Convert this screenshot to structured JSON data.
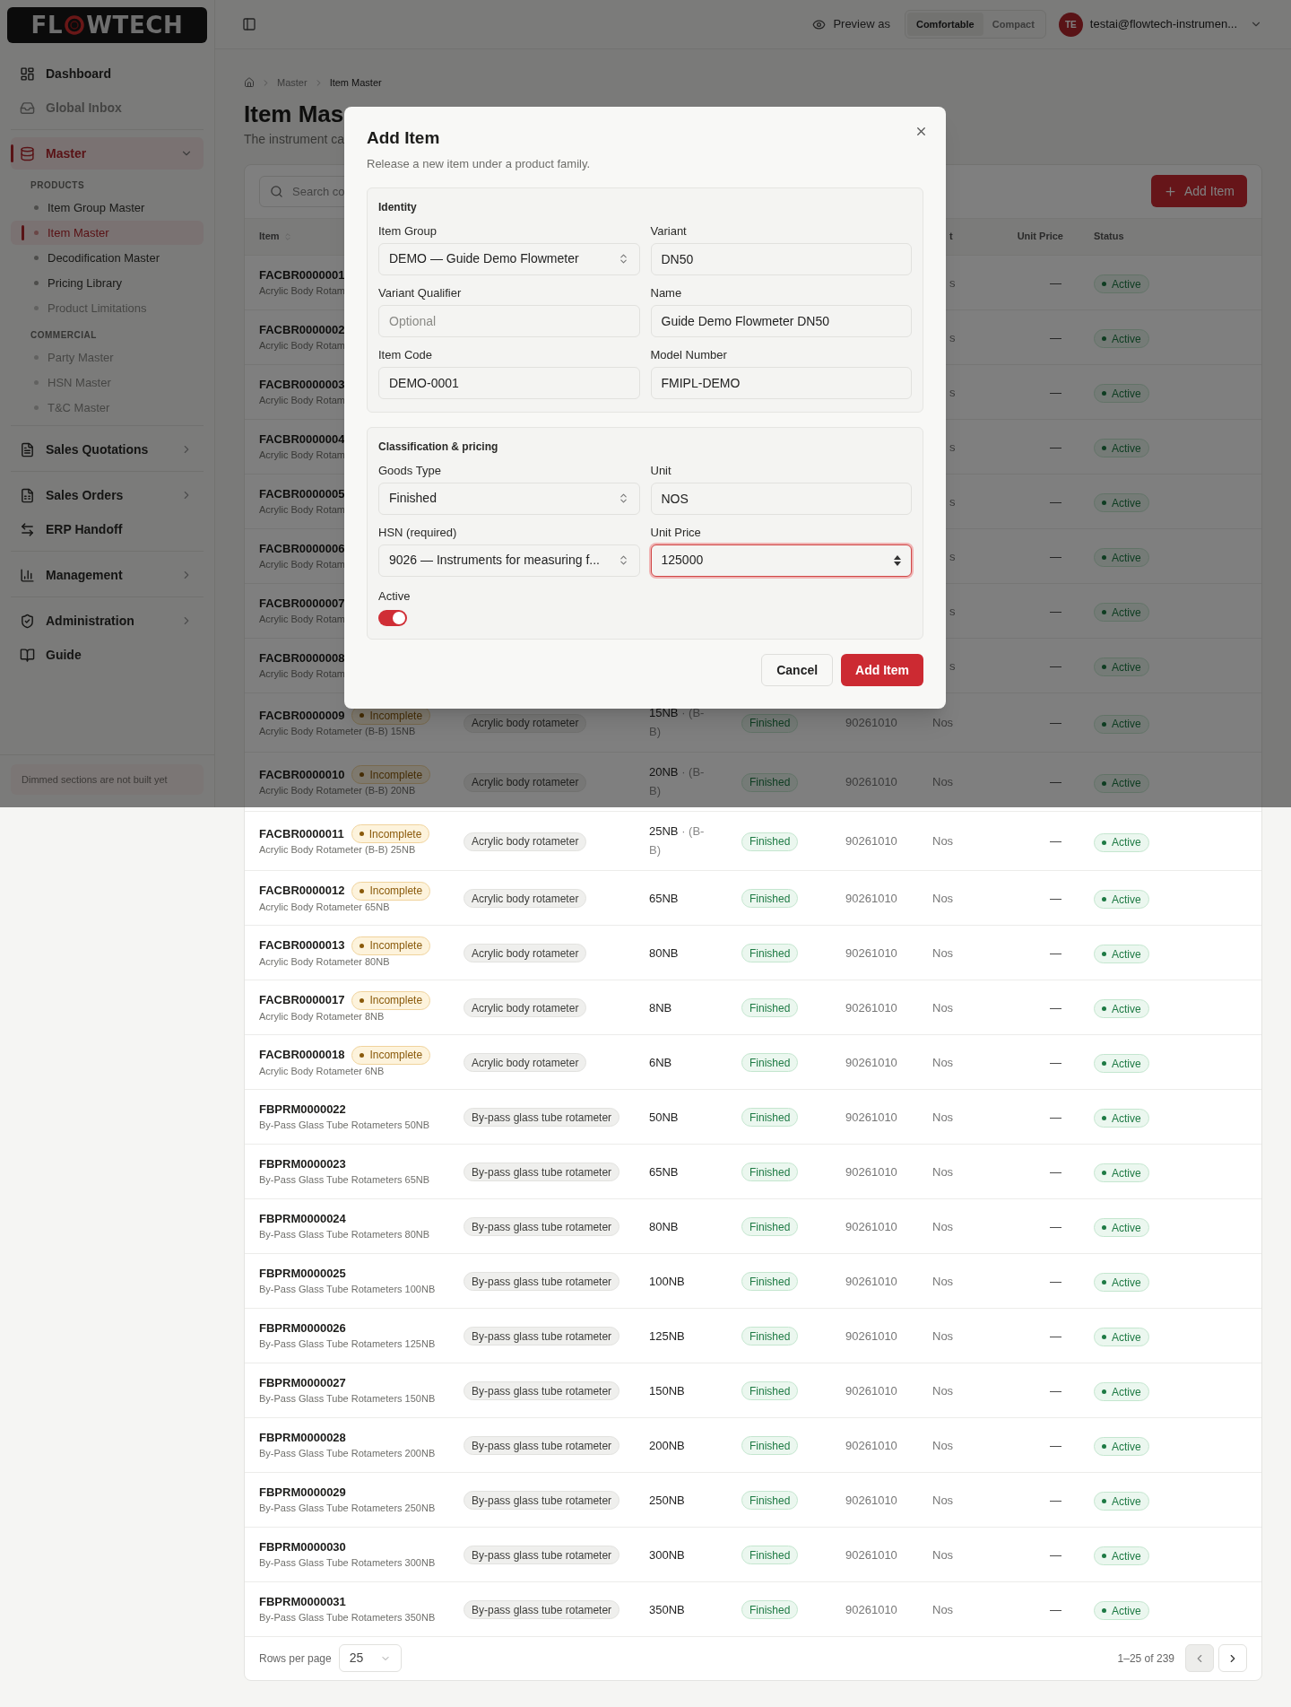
{
  "sidebar": {
    "logo": {
      "parts": [
        "FL",
        "WTECH"
      ]
    },
    "groups": [
      [
        {
          "label": "Dashboard",
          "kind": "link",
          "selected": false,
          "dimmed": false
        },
        {
          "label": "Global Inbox",
          "kind": "link",
          "selected": false,
          "dimmed": true
        }
      ],
      [
        {
          "label": "Master",
          "kind": "expandable",
          "selected": true,
          "expanded": true,
          "sections": [
            {
              "heading": "PRODUCTS",
              "items": [
                {
                  "label": "Item Group Master",
                  "selected": false,
                  "dimmed": false
                },
                {
                  "label": "Item Master",
                  "selected": true
                },
                {
                  "label": "Decodification Master",
                  "selected": false,
                  "dimmed": false
                },
                {
                  "label": "Pricing Library",
                  "selected": false,
                  "dimmed": false
                },
                {
                  "label": "Product Limitations",
                  "selected": false,
                  "dimmed": true
                }
              ]
            },
            {
              "heading": "COMMERCIAL",
              "items": [
                {
                  "label": "Party Master",
                  "selected": false,
                  "dimmed": true
                },
                {
                  "label": "HSN Master",
                  "selected": false,
                  "dimmed": true
                },
                {
                  "label": "T&C Master",
                  "selected": false,
                  "dimmed": true
                }
              ]
            }
          ]
        }
      ],
      [
        {
          "label": "Sales Quotations",
          "kind": "expandable",
          "selected": false,
          "dimmed": false,
          "expanded": false
        }
      ],
      [
        {
          "label": "Sales Orders",
          "kind": "expandable",
          "selected": false,
          "dimmed": false,
          "expanded": false
        },
        {
          "label": "ERP Handoff",
          "kind": "link",
          "selected": false,
          "dimmed": false
        }
      ],
      [
        {
          "label": "Management",
          "kind": "expandable",
          "selected": false,
          "dimmed": false,
          "expanded": false
        }
      ],
      [
        {
          "label": "Administration",
          "kind": "expandable",
          "selected": false,
          "dimmed": false,
          "expanded": false
        },
        {
          "label": "Guide",
          "kind": "link",
          "selected": false,
          "dimmed": false
        }
      ]
    ],
    "footer_note": "Dimmed sections are not built yet"
  },
  "topbar": {
    "preview_label": "Preview as",
    "density": [
      {
        "label": "Comfortable",
        "selected": true
      },
      {
        "label": "Compact",
        "selected": false
      }
    ],
    "avatar": "TE",
    "email": "testai@flowtech-instrumen..."
  },
  "breadcrumb": [
    "Master",
    "Item Master"
  ],
  "page": {
    "title": "Item Mas",
    "description": "The instrument ca"
  },
  "toolbar": {
    "search": {
      "placeholder": "Search co"
    },
    "add_button": "Add Item"
  },
  "table": {
    "columns": {
      "item": "Item",
      "column_6": "t",
      "unit_price": "Unit Price",
      "status": "Status"
    },
    "rows": [
      {
        "kind": "partial",
        "code": "FACBR0000001",
        "name": "Acrylic Body Rotam",
        "unit": "s",
        "price": "—",
        "status": "Active"
      },
      {
        "kind": "partial",
        "code": "FACBR0000002",
        "name": "Acrylic Body Rotam",
        "unit": "s",
        "price": "—",
        "status": "Active"
      },
      {
        "kind": "partial",
        "code": "FACBR0000003",
        "name": "Acrylic Body Rotam",
        "unit": "s",
        "price": "—",
        "status": "Active"
      },
      {
        "kind": "partial",
        "code": "FACBR0000004",
        "name": "Acrylic Body Rotam",
        "unit": "s",
        "price": "—",
        "status": "Active"
      },
      {
        "kind": "partial",
        "code": "FACBR0000005",
        "name": "Acrylic Body Rotam",
        "unit": "s",
        "price": "—",
        "status": "Active"
      },
      {
        "kind": "partial",
        "code": "FACBR0000006",
        "name": "Acrylic Body Rotam",
        "unit": "s",
        "price": "—",
        "status": "Active"
      },
      {
        "kind": "partial",
        "code": "FACBR0000007",
        "name": "Acrylic Body Rotam",
        "unit": "s",
        "price": "—",
        "status": "Active"
      },
      {
        "kind": "partial",
        "code": "FACBR0000008",
        "name": "Acrylic Body Rotam",
        "unit": "s",
        "price": "—",
        "status": "Active"
      },
      {
        "kind": "full",
        "code": "FACBR0000009",
        "flag": "Incomplete",
        "name": "Acrylic Body Rotameter (B-B) 15NB",
        "group": "Acrylic body rotameter",
        "variant": "15NB",
        "qualifier": "· (B-B)",
        "goods": "Finished",
        "hsn": "90261010",
        "unit": "Nos",
        "price": "—",
        "status": "Active"
      },
      {
        "kind": "full",
        "code": "FACBR0000010",
        "flag": "Incomplete",
        "name": "Acrylic Body Rotameter (B-B) 20NB",
        "group": "Acrylic body rotameter",
        "variant": "20NB",
        "qualifier": "· (B-B)",
        "goods": "Finished",
        "hsn": "90261010",
        "unit": "Nos",
        "price": "—",
        "status": "Active"
      },
      {
        "kind": "full",
        "code": "FACBR0000011",
        "flag": "Incomplete",
        "name": "Acrylic Body Rotameter (B-B) 25NB",
        "group": "Acrylic body rotameter",
        "variant": "25NB",
        "qualifier": "· (B-B)",
        "goods": "Finished",
        "hsn": "90261010",
        "unit": "Nos",
        "price": "—",
        "status": "Active"
      },
      {
        "kind": "full",
        "code": "FACBR0000012",
        "flag": "Incomplete",
        "name": "Acrylic Body Rotameter 65NB",
        "group": "Acrylic body rotameter",
        "variant": "65NB",
        "goods": "Finished",
        "hsn": "90261010",
        "unit": "Nos",
        "price": "—",
        "status": "Active"
      },
      {
        "kind": "full",
        "code": "FACBR0000013",
        "flag": "Incomplete",
        "name": "Acrylic Body Rotameter 80NB",
        "group": "Acrylic body rotameter",
        "variant": "80NB",
        "goods": "Finished",
        "hsn": "90261010",
        "unit": "Nos",
        "price": "—",
        "status": "Active"
      },
      {
        "kind": "full",
        "code": "FACBR0000017",
        "flag": "Incomplete",
        "name": "Acrylic Body Rotameter 8NB",
        "group": "Acrylic body rotameter",
        "variant": "8NB",
        "goods": "Finished",
        "hsn": "90261010",
        "unit": "Nos",
        "price": "—",
        "status": "Active"
      },
      {
        "kind": "full",
        "code": "FACBR0000018",
        "flag": "Incomplete",
        "name": "Acrylic Body Rotameter 6NB",
        "group": "Acrylic body rotameter",
        "variant": "6NB",
        "goods": "Finished",
        "hsn": "90261010",
        "unit": "Nos",
        "price": "—",
        "status": "Active"
      },
      {
        "kind": "full",
        "code": "FBPRM0000022",
        "name": "By-Pass Glass Tube Rotameters 50NB",
        "group": "By-pass glass tube rotameter",
        "variant": "50NB",
        "goods": "Finished",
        "hsn": "90261010",
        "unit": "Nos",
        "price": "—",
        "status": "Active"
      },
      {
        "kind": "full",
        "code": "FBPRM0000023",
        "name": "By-Pass Glass Tube Rotameters 65NB",
        "group": "By-pass glass tube rotameter",
        "variant": "65NB",
        "goods": "Finished",
        "hsn": "90261010",
        "unit": "Nos",
        "price": "—",
        "status": "Active"
      },
      {
        "kind": "full",
        "code": "FBPRM0000024",
        "name": "By-Pass Glass Tube Rotameters 80NB",
        "group": "By-pass glass tube rotameter",
        "variant": "80NB",
        "goods": "Finished",
        "hsn": "90261010",
        "unit": "Nos",
        "price": "—",
        "status": "Active"
      },
      {
        "kind": "full",
        "code": "FBPRM0000025",
        "name": "By-Pass Glass Tube Rotameters 100NB",
        "group": "By-pass glass tube rotameter",
        "variant": "100NB",
        "goods": "Finished",
        "hsn": "90261010",
        "unit": "Nos",
        "price": "—",
        "status": "Active"
      },
      {
        "kind": "full",
        "code": "FBPRM0000026",
        "name": "By-Pass Glass Tube Rotameters 125NB",
        "group": "By-pass glass tube rotameter",
        "variant": "125NB",
        "goods": "Finished",
        "hsn": "90261010",
        "unit": "Nos",
        "price": "—",
        "status": "Active"
      },
      {
        "kind": "full",
        "code": "FBPRM0000027",
        "name": "By-Pass Glass Tube Rotameters 150NB",
        "group": "By-pass glass tube rotameter",
        "variant": "150NB",
        "goods": "Finished",
        "hsn": "90261010",
        "unit": "Nos",
        "price": "—",
        "status": "Active"
      },
      {
        "kind": "full",
        "code": "FBPRM0000028",
        "name": "By-Pass Glass Tube Rotameters 200NB",
        "group": "By-pass glass tube rotameter",
        "variant": "200NB",
        "goods": "Finished",
        "hsn": "90261010",
        "unit": "Nos",
        "price": "—",
        "status": "Active"
      },
      {
        "kind": "full",
        "code": "FBPRM0000029",
        "name": "By-Pass Glass Tube Rotameters 250NB",
        "group": "By-pass glass tube rotameter",
        "variant": "250NB",
        "goods": "Finished",
        "hsn": "90261010",
        "unit": "Nos",
        "price": "—",
        "status": "Active"
      },
      {
        "kind": "full",
        "code": "FBPRM0000030",
        "name": "By-Pass Glass Tube Rotameters 300NB",
        "group": "By-pass glass tube rotameter",
        "variant": "300NB",
        "goods": "Finished",
        "hsn": "90261010",
        "unit": "Nos",
        "price": "—",
        "status": "Active"
      },
      {
        "kind": "full",
        "code": "FBPRM0000031",
        "name": "By-Pass Glass Tube Rotameters 350NB",
        "group": "By-pass glass tube rotameter",
        "variant": "350NB",
        "goods": "Finished",
        "hsn": "90261010",
        "unit": "Nos",
        "price": "—",
        "status": "Active"
      }
    ]
  },
  "pagination": {
    "rows_label": "Rows per page",
    "rows_per_page": "25",
    "range": "1–25 of 239",
    "prev_disabled": true
  },
  "modal": {
    "title": "Add Item",
    "subtitle": "Release a new item under a product family.",
    "sections": [
      {
        "title": "Identity",
        "fields": [
          {
            "label": "Item Group",
            "kind": "select",
            "value": "DEMO — Guide Demo Flowmeter"
          },
          {
            "label": "Variant",
            "kind": "text",
            "value": "DN50"
          },
          {
            "label": "Variant Qualifier",
            "kind": "text",
            "placeholder": "Optional"
          },
          {
            "label": "Name",
            "kind": "text",
            "value": "Guide Demo Flowmeter DN50"
          },
          {
            "label": "Item Code",
            "kind": "text",
            "value": "DEMO-0001"
          },
          {
            "label": "Model Number",
            "kind": "text",
            "value": "FMIPL-DEMO"
          }
        ]
      },
      {
        "title": "Classification & pricing",
        "fields": [
          {
            "label": "Goods Type",
            "kind": "select",
            "value": "Finished"
          },
          {
            "label": "Unit",
            "kind": "text",
            "value": "NOS"
          },
          {
            "label": "HSN (required)",
            "kind": "select",
            "value": "9026 — Instruments for measuring f..."
          },
          {
            "label": "Unit Price",
            "kind": "number",
            "value": "125000",
            "focused": true
          }
        ],
        "toggle": {
          "label": "Active",
          "on": true
        }
      }
    ],
    "buttons": [
      {
        "label": "Cancel",
        "kind": "secondary"
      },
      {
        "label": "Add Item",
        "kind": "primary"
      }
    ]
  }
}
